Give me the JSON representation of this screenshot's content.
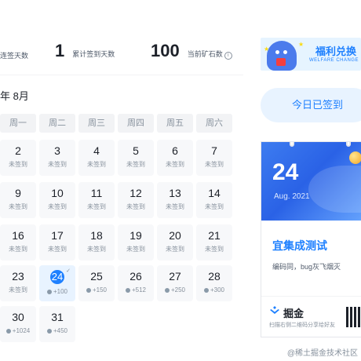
{
  "stats": {
    "left_label": "连签天数",
    "cumulative": {
      "value": "1",
      "label": "累计签到天数"
    },
    "ore": {
      "value": "100",
      "label": "当前矿石数",
      "info_icon": "i"
    }
  },
  "calendar": {
    "month_label": "年 8月",
    "weekdays": [
      "周一",
      "周二",
      "周三",
      "周四",
      "周五",
      "周六"
    ],
    "days": [
      {
        "n": "2",
        "s": "未签到"
      },
      {
        "n": "3",
        "s": "未签到"
      },
      {
        "n": "4",
        "s": "未签到"
      },
      {
        "n": "5",
        "s": "未签到"
      },
      {
        "n": "6",
        "s": "未签到"
      },
      {
        "n": "7",
        "s": "未签到"
      },
      {
        "n": "9",
        "s": "未签到"
      },
      {
        "n": "10",
        "s": "未签到"
      },
      {
        "n": "11",
        "s": "未签到"
      },
      {
        "n": "12",
        "s": "未签到"
      },
      {
        "n": "13",
        "s": "未签到"
      },
      {
        "n": "14",
        "s": "未签到"
      },
      {
        "n": "16",
        "s": "未签到"
      },
      {
        "n": "17",
        "s": "未签到"
      },
      {
        "n": "18",
        "s": "未签到"
      },
      {
        "n": "19",
        "s": "未签到"
      },
      {
        "n": "20",
        "s": "未签到"
      },
      {
        "n": "21",
        "s": "未签到"
      },
      {
        "n": "23",
        "s": "未签到"
      },
      {
        "n": "24",
        "s": "+100"
      },
      {
        "n": "25",
        "s": "+150"
      },
      {
        "n": "26",
        "s": "+512"
      },
      {
        "n": "27",
        "s": "+250"
      },
      {
        "n": "28",
        "s": "+300"
      },
      {
        "n": "30",
        "s": "+1024"
      },
      {
        "n": "31",
        "s": "+450"
      }
    ],
    "today_check": "✓"
  },
  "banner": {
    "title": "福利兑换",
    "subtitle": "WELFARE CHANGE"
  },
  "signed_button": "今日已签到",
  "card": {
    "day": "24",
    "month_year": "Aug. 2021",
    "headline": "宜集成测试",
    "slogan": "编码同，bug灰飞烟灭",
    "brand": "掘金",
    "scan_text": "扫描右侧二维码分享给好友"
  },
  "watermark": "@稀土掘金技术社区",
  "colors": {
    "accent": "#1e80ff",
    "tile_bg": "#f7f8fa",
    "today_bg": "#e8f3ff"
  }
}
